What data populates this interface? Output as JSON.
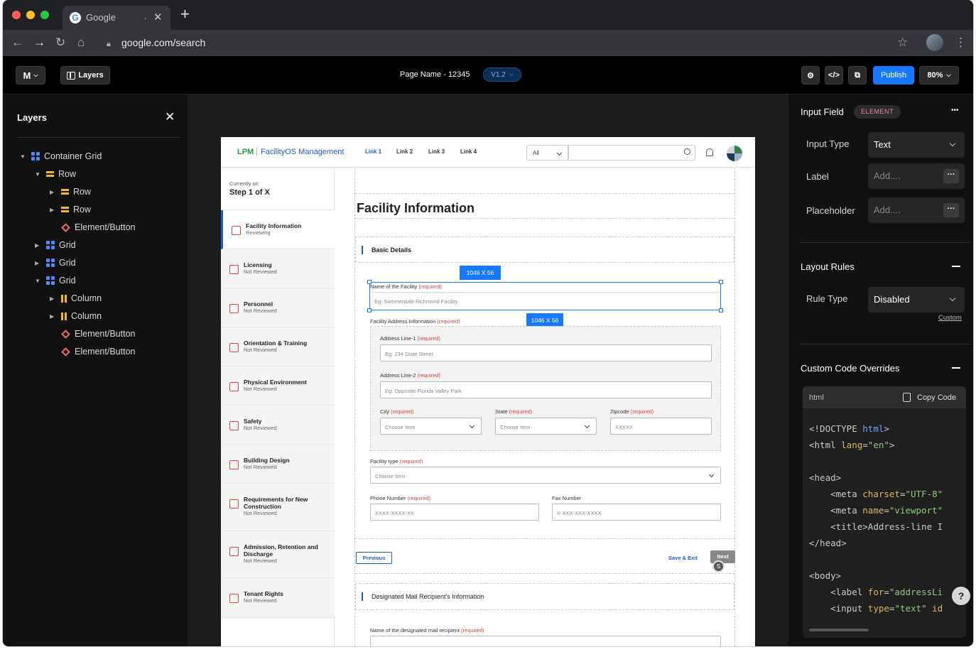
{
  "browser": {
    "tab_title": "Google",
    "tab_dots": ".",
    "url": "google.com/search"
  },
  "app_header": {
    "menu_label": "M",
    "layers_label": "Layers",
    "page_name": "Page Name - 12345",
    "version": "V1.2",
    "publish": "Publish",
    "zoom": "80%"
  },
  "layers": {
    "title": "Layers",
    "items": [
      {
        "label": "Container Grid",
        "icon": "grid-icon",
        "caret": "open"
      },
      {
        "label": "Row",
        "icon": "row-icon",
        "caret": "open"
      },
      {
        "label": "Row",
        "icon": "row-icon",
        "caret": "closed"
      },
      {
        "label": "Row",
        "icon": "row-icon",
        "caret": "closed"
      },
      {
        "label": "Element/Button",
        "icon": "element-icon",
        "caret": "none"
      },
      {
        "label": "Grid",
        "icon": "grid-icon",
        "caret": "closed"
      },
      {
        "label": "Grid",
        "icon": "grid-icon",
        "caret": "closed"
      },
      {
        "label": "Grid",
        "icon": "grid-icon",
        "caret": "open"
      },
      {
        "label": "Column",
        "icon": "column-icon",
        "caret": "closed"
      },
      {
        "label": "Column",
        "icon": "column-icon",
        "caret": "closed"
      },
      {
        "label": "Element/Button",
        "icon": "element-icon",
        "caret": "none"
      },
      {
        "label": "Element/Button",
        "icon": "element-icon",
        "caret": "none"
      }
    ]
  },
  "frame": {
    "brand": "LPM",
    "product": "FacilityOS Management",
    "links": [
      "Link 1",
      "Link 2",
      "Link 3",
      "Link 4"
    ],
    "filter": "All",
    "step_header": {
      "small": "Currently on",
      "big": "Step 1 of X"
    },
    "steps": [
      {
        "name": "Facility Information",
        "status": "Reviewing"
      },
      {
        "name": "Licensing",
        "status": "Not Reviewed"
      },
      {
        "name": "Personnel",
        "status": "Not Reviewed"
      },
      {
        "name": "Orientation & Training",
        "status": "Not Reviewed"
      },
      {
        "name": "Physical Environment",
        "status": "Not Reviewed"
      },
      {
        "name": "Safety",
        "status": "Not Reviewed"
      },
      {
        "name": "Building Design",
        "status": "Not Reviewed"
      },
      {
        "name": "Requirements for New Construction",
        "status": "Not Reviewed"
      },
      {
        "name": "Admission, Retention and Discharge",
        "status": "Not Reviewed"
      },
      {
        "name": "Tenant Rights",
        "status": "Not Reviewed"
      }
    ],
    "page_title": "Facility Information",
    "section1": "Basic Details",
    "dim_badge": "1046 X 56",
    "dim_badge2": "1046 X 56",
    "required": "(required)",
    "facility_name": {
      "label": "Name of the Facility",
      "placeholder": "Eg: Summerdale Richmond Facility"
    },
    "address_label": "Facility Address Information",
    "addr1": {
      "label": "Address Line-1",
      "placeholder": "Eg: 234 State Street"
    },
    "addr2": {
      "label": "Address Line-2",
      "placeholder": "Eg: Opposite Florida Valley Park"
    },
    "city": {
      "label": "City",
      "placeholder": "Choose Item"
    },
    "state": {
      "label": "State",
      "placeholder": "Choose Item"
    },
    "zip": {
      "label": "Zipcode",
      "placeholder": "XXXXX"
    },
    "ftype": {
      "label": "Facility type",
      "placeholder": "Choose Item"
    },
    "phone": {
      "label": "Phone Number",
      "placeholder": "XXXX-XXXX-XX"
    },
    "fax": {
      "label": "Fax Number",
      "placeholder": "X-XXX-XXX-XXXX"
    },
    "previous": "Previous",
    "save_exit": "Save & Exit",
    "next": "Next",
    "avatar_letter": "S",
    "section2": "Designated Mail Recipient's Information",
    "recipient": {
      "label": "Name of the designated mail recipient"
    }
  },
  "properties": {
    "title": "Input Field",
    "badge": "ELEMENT",
    "more": "•••",
    "input_type_label": "Input Type",
    "input_type_value": "Text",
    "label_label": "Label",
    "label_placeholder": "Add....",
    "placeholder_label": "Placeholder",
    "placeholder_placeholder": "Add....",
    "layout_title": "Layout Rules",
    "rule_type_label": "Rule Type",
    "rule_type_value": "Disabled",
    "custom_link": "Custom",
    "code_title": "Custom Code Overrides",
    "code_lang": "html",
    "copy_code": "Copy Code",
    "help": "?"
  },
  "colors": {
    "accent": "#1677ff",
    "required": "#d9453c",
    "brand_green": "#2e9a3d"
  }
}
